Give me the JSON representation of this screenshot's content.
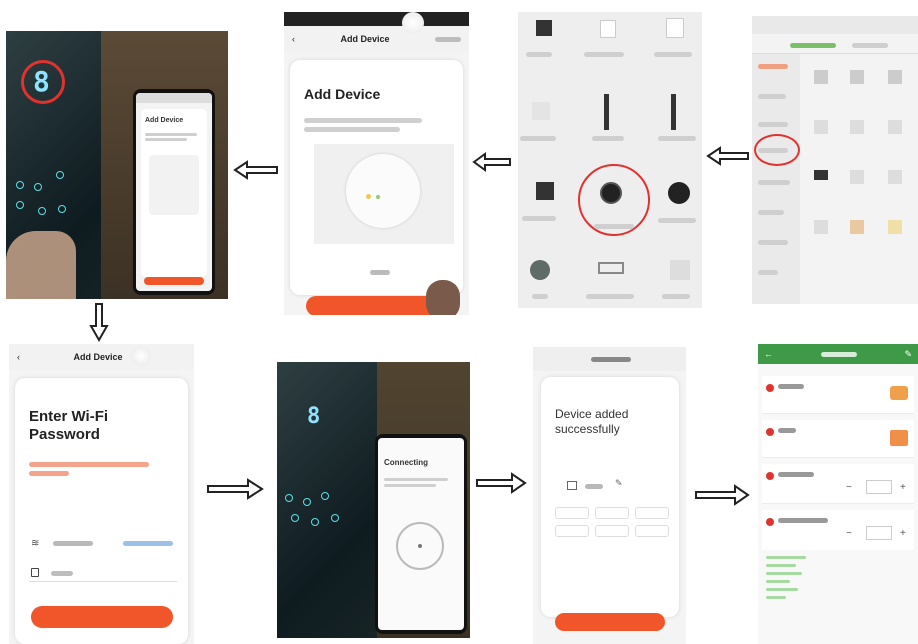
{
  "steps": {
    "p1": {
      "screen_title": "Add Device"
    },
    "p2": {
      "header": "Add Device",
      "title": "Add Device"
    },
    "p5": {
      "header": "Add Device",
      "title_line1": "Enter Wi-Fi",
      "title_line2": "Password"
    },
    "p6": {
      "title": "Connecting"
    },
    "p7": {
      "title_line1": "Device added",
      "title_line2": "successfully"
    }
  },
  "arrows": {
    "row1_direction": "left",
    "down_direction": "down",
    "row2_direction": "right"
  },
  "colors": {
    "accent": "#f0562a",
    "highlight_ring": "#e0322f",
    "display_digit": "#8fe3ff",
    "touch_key": "#5de0e6"
  }
}
